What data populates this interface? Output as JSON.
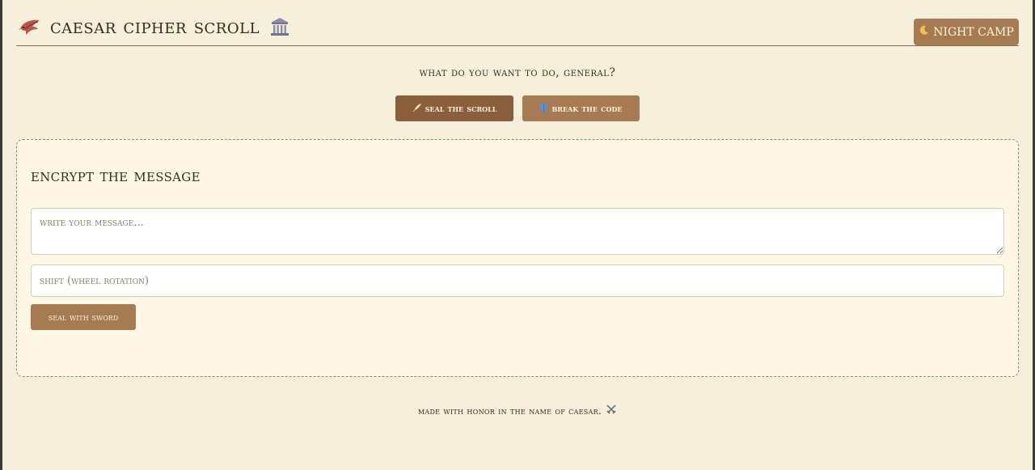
{
  "header": {
    "title": "CAESAR CIPHER SCROLL",
    "brand_icon": "eagle-icon",
    "title_icon": "classical-building-icon",
    "theme_button": {
      "label": "NIGHT CAMP",
      "icon": "moon-icon"
    }
  },
  "prompt": "WHAT DO YOU WANT TO DO, GENERAL?",
  "modes": [
    {
      "label": "SEAL THE SCROLL",
      "icon": "quill-icon",
      "active": true
    },
    {
      "label": "BREAK THE CODE",
      "icon": "shield-icon",
      "active": false
    }
  ],
  "panel": {
    "title": "ENCRYPT THE MESSAGE",
    "message_placeholder": "WRITE YOUR MESSAGE...",
    "shift_placeholder": "SHIFT (WHEEL ROTATION)",
    "submit_label": "SEAL WITH SWORD"
  },
  "footer": {
    "text": "MADE WITH HONOR IN THE NAME OF CAESAR.",
    "icon": "crossed-swords-icon"
  },
  "colors": {
    "background": "#f5efdc",
    "panel": "#fff8e6",
    "accent": "#a67b52",
    "accent_dark": "#8b5e3c",
    "text": "#3b2a1a"
  }
}
